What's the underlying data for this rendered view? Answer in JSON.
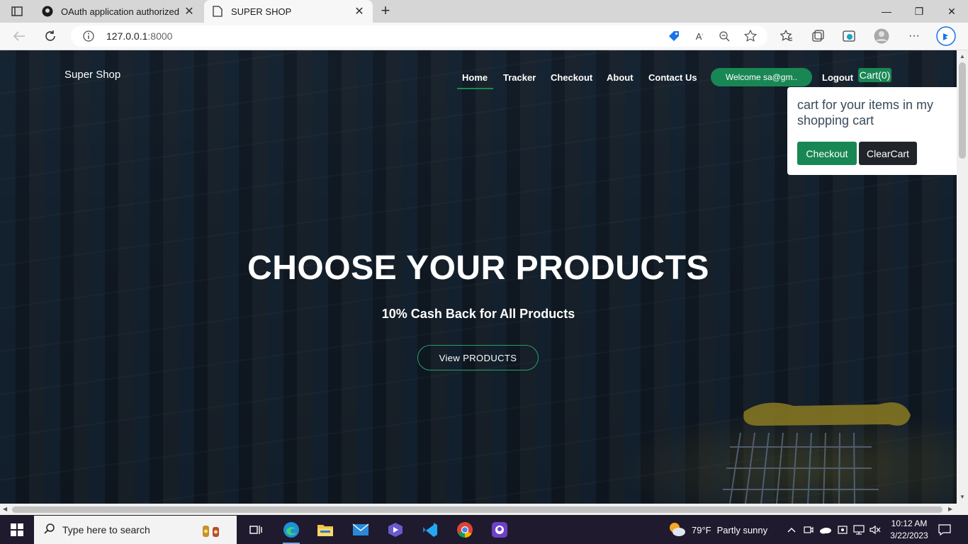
{
  "browser": {
    "tabs": [
      {
        "title": "OAuth application authorized",
        "icon": "github-icon"
      },
      {
        "title": "SUPER SHOP",
        "icon": "page-icon"
      }
    ],
    "address": {
      "host": "127.0.0.1",
      "port": ":8000"
    }
  },
  "site": {
    "brand": "Super Shop",
    "nav": {
      "home": "Home",
      "tracker": "Tracker",
      "checkout": "Checkout",
      "about": "About",
      "contact": "Contact Us"
    },
    "welcome": "Welcome sa@gm..",
    "logout": "Logout",
    "cart": "Cart(0)",
    "popover": {
      "text": "cart for your items in my shopping cart",
      "checkout": "Checkout",
      "clear": "ClearCart"
    },
    "hero": {
      "title": "CHOOSE YOUR PRODUCTS",
      "subtitle": "10% Cash Back for All Products",
      "button": "View PRODUCTS"
    }
  },
  "taskbar": {
    "search_placeholder": "Type here to search",
    "weather": {
      "temp": "79°F",
      "condition": "Partly sunny"
    },
    "clock": {
      "time": "10:12 AM",
      "date": "3/22/2023"
    }
  },
  "colors": {
    "accent": "#198754",
    "dark_button": "#212529"
  }
}
